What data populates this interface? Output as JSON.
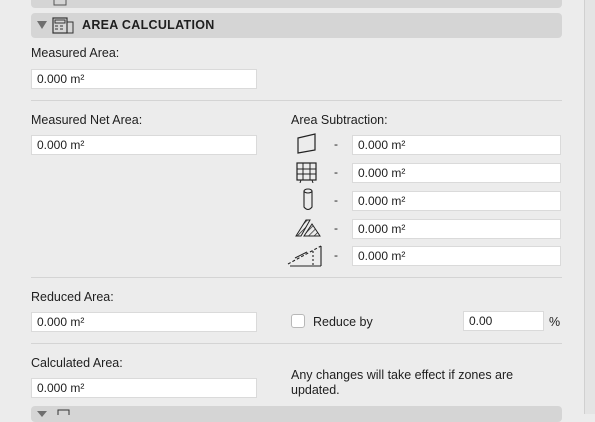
{
  "section": {
    "title": "AREA CALCULATION",
    "expanded_icon": "triangle-down",
    "section_icon": "area-calc-icon"
  },
  "measured_area": {
    "label": "Measured Area:",
    "value": "0.000 m²"
  },
  "measured_net_area": {
    "label": "Measured Net Area:",
    "value": "0.000 m²"
  },
  "area_subtraction": {
    "label": "Area Subtraction:",
    "rows": [
      {
        "icon": "slab-shape-icon",
        "dash": "-",
        "value": "0.000 m²"
      },
      {
        "icon": "curtain-wall-grid-icon",
        "dash": "-",
        "value": "0.000 m²"
      },
      {
        "icon": "column-icon",
        "dash": "-",
        "value": "0.000 m²"
      },
      {
        "icon": "hatched-fill-icon",
        "dash": "-",
        "value": "0.000 m²"
      },
      {
        "icon": "low-height-roof-icon",
        "dash": "-",
        "value": "0.000 m²"
      }
    ]
  },
  "reduced_area": {
    "label": "Reduced Area:",
    "value": "0.000 m²"
  },
  "reduce_by": {
    "label": "Reduce by",
    "checked": false,
    "value": "0.00",
    "unit": "%"
  },
  "calculated_area": {
    "label": "Calculated Area:",
    "value": "0.000 m²"
  },
  "note": "Any changes will take effect if zones are updated."
}
